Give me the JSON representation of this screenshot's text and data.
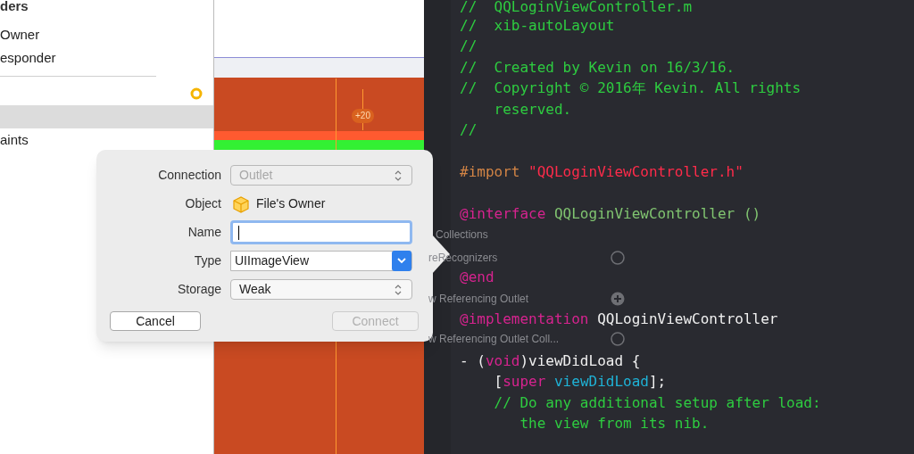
{
  "sidebar": {
    "items": [
      {
        "kind": "heading",
        "label": "ders",
        "selected": false
      },
      {
        "kind": "item",
        "label": "Owner",
        "selected": false
      },
      {
        "kind": "item",
        "label": "esponder",
        "selected": false
      },
      {
        "kind": "divider",
        "selected": false
      },
      {
        "kind": "status",
        "selected": false
      },
      {
        "kind": "blank",
        "selected": true
      },
      {
        "kind": "item",
        "label": "aints",
        "selected": false
      }
    ]
  },
  "canvas": {
    "badge": "+20"
  },
  "dialog": {
    "fields": [
      {
        "kind": "popup",
        "label": "Connection",
        "value": "Outlet",
        "disabled": true
      },
      {
        "kind": "object",
        "label": "Object",
        "value": "File's Owner"
      },
      {
        "kind": "text",
        "label": "Name",
        "focused": true
      },
      {
        "kind": "combo",
        "label": "Type",
        "value": "UIImageView"
      },
      {
        "kind": "popup",
        "label": "Storage",
        "value": "Weak",
        "disabled": false
      }
    ],
    "buttons": [
      {
        "label": "Cancel",
        "disabled": false
      },
      {
        "label": "Connect",
        "disabled": true
      }
    ]
  },
  "inspector_ghost": {
    "rows": [
      {
        "kind": "plain",
        "label": "Collections"
      },
      {
        "kind": "circle",
        "label": "reRecognizers"
      },
      {
        "kind": "plus",
        "label": "w Referencing Outlet"
      },
      {
        "kind": "circle",
        "label": "w Referencing Outlet Coll..."
      }
    ]
  },
  "editor": {
    "lines": [
      {
        "kind": "code",
        "tokens": [
          {
            "kind": "comment",
            "text": "//  QQLoginViewController.m"
          }
        ]
      },
      {
        "kind": "code",
        "tokens": [
          {
            "kind": "comment",
            "text": "//  xib-autoLayout"
          }
        ]
      },
      {
        "kind": "code",
        "tokens": [
          {
            "kind": "comment",
            "text": "//"
          }
        ]
      },
      {
        "kind": "code",
        "tokens": [
          {
            "kind": "comment",
            "text": "//  Created by Kevin on 16/3/16."
          }
        ]
      },
      {
        "kind": "code",
        "tokens": [
          {
            "kind": "comment",
            "text": "//  Copyright © 2016年 Kevin. All rights"
          }
        ]
      },
      {
        "kind": "code",
        "tokens": [
          {
            "kind": "comment",
            "text": "    reserved."
          }
        ]
      },
      {
        "kind": "code",
        "tokens": [
          {
            "kind": "comment",
            "text": "//"
          }
        ]
      },
      {
        "kind": "blank"
      },
      {
        "kind": "code",
        "tokens": [
          {
            "kind": "preproc",
            "text": "#import "
          },
          {
            "kind": "string",
            "text": "\"QQLoginViewController.h\""
          }
        ]
      },
      {
        "kind": "blank"
      },
      {
        "kind": "code",
        "tokens": [
          {
            "kind": "keyword",
            "text": "@interface"
          },
          {
            "kind": "class",
            "text": " QQLoginViewController ()"
          }
        ]
      },
      {
        "kind": "blank"
      },
      {
        "kind": "blank"
      },
      {
        "kind": "code",
        "tokens": [
          {
            "kind": "keyword",
            "text": "@end"
          }
        ]
      },
      {
        "kind": "blank"
      },
      {
        "kind": "code",
        "tokens": [
          {
            "kind": "keyword",
            "text": "@implementation"
          },
          {
            "kind": "plain",
            "text": " QQLoginViewController"
          }
        ]
      },
      {
        "kind": "blank"
      },
      {
        "kind": "code",
        "tokens": [
          {
            "kind": "plain",
            "text": "- ("
          },
          {
            "kind": "keyword",
            "text": "void"
          },
          {
            "kind": "plain",
            "text": ")viewDidLoad {"
          }
        ]
      },
      {
        "kind": "code",
        "tokens": [
          {
            "kind": "plain",
            "text": "    ["
          },
          {
            "kind": "keyword",
            "text": "super"
          },
          {
            "kind": "method",
            "text": " viewDidLoad"
          },
          {
            "kind": "plain",
            "text": "];"
          }
        ]
      },
      {
        "kind": "code",
        "tokens": [
          {
            "kind": "comment",
            "text": "    // Do any additional setup after load:"
          }
        ]
      },
      {
        "kind": "code",
        "tokens": [
          {
            "kind": "comment",
            "text": "       the view from its nib."
          }
        ]
      }
    ]
  }
}
